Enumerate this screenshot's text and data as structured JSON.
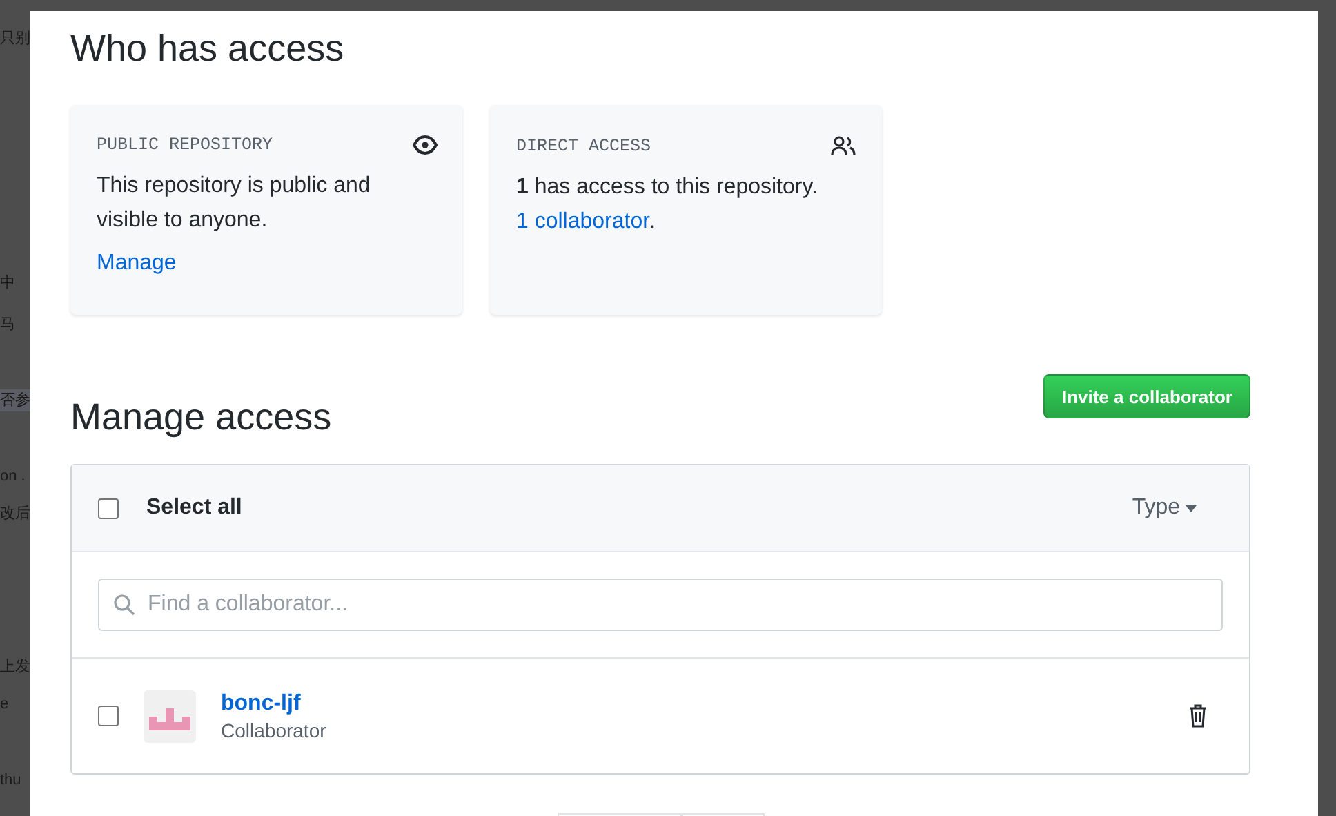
{
  "backdrop": {
    "fragments": [
      {
        "text": "只别",
        "highlighted": false
      },
      {
        "text": "中",
        "highlighted": false
      },
      {
        "text": "马",
        "highlighted": false
      },
      {
        "text": "否参",
        "highlighted": true
      },
      {
        "text": "on .",
        "highlighted": false
      },
      {
        "text": "改后",
        "highlighted": false
      },
      {
        "text": "上发",
        "highlighted": false
      },
      {
        "text": "e",
        "highlighted": false
      },
      {
        "text": "thu",
        "highlighted": false
      }
    ]
  },
  "who_has_access": {
    "title": "Who has access",
    "cards": [
      {
        "kind": "public",
        "heading": "PUBLIC REPOSITORY",
        "text": "This repository is public and visible to anyone.",
        "link": "Manage"
      },
      {
        "kind": "direct",
        "heading": "DIRECT ACCESS",
        "text": "**1** has access to this repository.",
        "link": "1 collaborator",
        "after": "."
      }
    ]
  },
  "manage_access": {
    "title": "Manage access",
    "invite_button": "Invite a collaborator",
    "select_all": {
      "label": "Select all",
      "checked": false
    },
    "type_filter": "Type",
    "search": {
      "placeholder": "Find a collaborator..."
    },
    "collaborators": [
      {
        "name": "bonc-ljf",
        "role": "Collaborator",
        "checked": false
      }
    ]
  }
}
